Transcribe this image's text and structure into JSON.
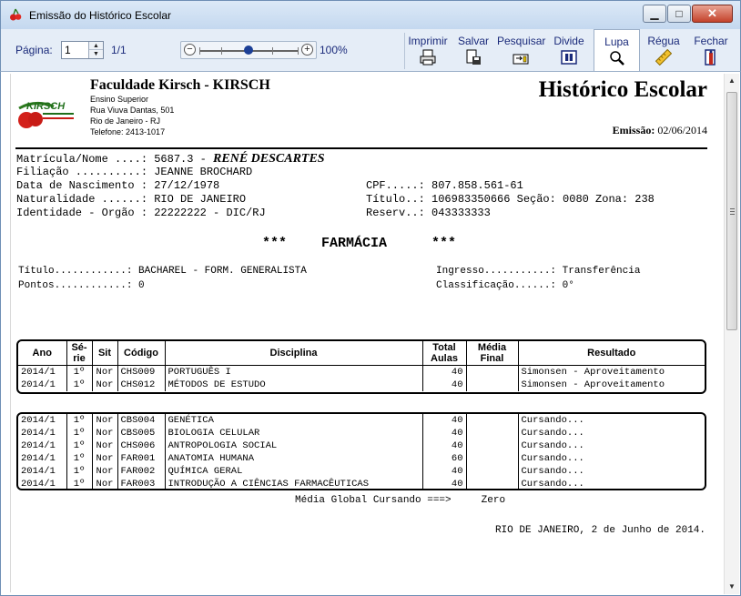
{
  "window": {
    "title": "Emissão do Histórico Escolar",
    "min_glyph": "▁",
    "max_glyph": "□",
    "close_glyph": "✕"
  },
  "toolbar": {
    "page_label": "Página:",
    "page_value": "1",
    "page_total": "1/1",
    "zoom_value": "100%",
    "buttons": {
      "imprimir": "Imprimir",
      "salvar": "Salvar",
      "pesquisar": "Pesquisar",
      "divide": "Divide",
      "lupa": "Lupa",
      "regua": "Régua",
      "fechar": "Fechar"
    }
  },
  "document": {
    "institution": {
      "name": "Faculdade Kirsch - KIRSCH",
      "lines": [
        "Ensino Superior",
        "Rua Viuva Dantas, 501",
        "Rio de Janeiro - RJ",
        "Telefone: 2413-1017"
      ],
      "logo_text": "KIRSCH"
    },
    "title": "Histórico Escolar",
    "emissao_label": "Emissão:",
    "emissao_date": "02/06/2014",
    "student": {
      "matricula_label": "Matrícula/Nome ....:",
      "matricula_value": "5687.3 -",
      "name": "RENÉ DESCARTES",
      "filiacao_label": "Filiação ..........:",
      "filiacao_value": "JEANNE BROCHARD",
      "nascimento_label": "Data de Nascimento :",
      "nascimento_value": "27/12/1978",
      "naturalidade_label": "Naturalidade ......:",
      "naturalidade_value": "RIO DE JANEIRO",
      "identidade_label": "Identidade - Orgão :",
      "identidade_value": "22222222 - DIC/RJ",
      "cpf_label": "CPF.....:",
      "cpf_value": "807.858.561-61",
      "titulo_label": "Título..:",
      "titulo_value": "106983350666 Seção: 0080 Zona: 238",
      "reserv_label": "Reserv..:",
      "reserv_value": "043333333"
    },
    "course": {
      "stars_left": "***",
      "name": "FARMÁCIA",
      "stars_right": "***"
    },
    "academic": {
      "titulo_label": "Título............:",
      "titulo_value": "BACHAREL - FORM. GENERALISTA",
      "pontos_label": "Pontos............:",
      "pontos_value": "0",
      "ingresso_label": "Ingresso...........:",
      "ingresso_value": "Transferência",
      "classificacao_label": "Classificação......:",
      "classificacao_value": "0°"
    },
    "table": {
      "headers": {
        "ano": "Ano",
        "serie": "Sé-\nrie",
        "sit": "Sit",
        "codigo": "Código",
        "disciplina": "Disciplina",
        "total_aulas": "Total\nAulas",
        "media_final": "Média\nFinal",
        "resultado": "Resultado"
      },
      "completed": [
        {
          "ano": "2014/1",
          "serie": "1º",
          "sit": "Nor",
          "codigo": "CHS009",
          "disciplina": "PORTUGUÊS I",
          "aulas": "40",
          "media": "",
          "resultado": "Simonsen - Aproveitamento"
        },
        {
          "ano": "2014/1",
          "serie": "1º",
          "sit": "Nor",
          "codigo": "CHS012",
          "disciplina": "MÉTODOS DE ESTUDO",
          "aulas": "40",
          "media": "",
          "resultado": "Simonsen - Aproveitamento"
        }
      ],
      "current": [
        {
          "ano": "2014/1",
          "serie": "1º",
          "sit": "Nor",
          "codigo": "CBS004",
          "disciplina": "GENÉTICA",
          "aulas": "40",
          "media": "",
          "resultado": "Cursando..."
        },
        {
          "ano": "2014/1",
          "serie": "1º",
          "sit": "Nor",
          "codigo": "CBS005",
          "disciplina": "BIOLOGIA CELULAR",
          "aulas": "40",
          "media": "",
          "resultado": "Cursando..."
        },
        {
          "ano": "2014/1",
          "serie": "1º",
          "sit": "Nor",
          "codigo": "CHS006",
          "disciplina": "ANTROPOLOGIA SOCIAL",
          "aulas": "40",
          "media": "",
          "resultado": "Cursando..."
        },
        {
          "ano": "2014/1",
          "serie": "1º",
          "sit": "Nor",
          "codigo": "FAR001",
          "disciplina": "ANATOMIA HUMANA",
          "aulas": "60",
          "media": "",
          "resultado": "Cursando..."
        },
        {
          "ano": "2014/1",
          "serie": "1º",
          "sit": "Nor",
          "codigo": "FAR002",
          "disciplina": "QUÍMICA GERAL",
          "aulas": "40",
          "media": "",
          "resultado": "Cursando..."
        },
        {
          "ano": "2014/1",
          "serie": "1º",
          "sit": "Nor",
          "codigo": "FAR003",
          "disciplina": "INTRODUÇÃO A CIÊNCIAS FARMACÊUTICAS",
          "aulas": "40",
          "media": "",
          "resultado": "Cursando..."
        }
      ]
    },
    "media_global_label": "Média Global Cursando ===>",
    "media_global_value": "Zero",
    "place_date": "RIO DE JANEIRO, 2 de Junho de 2014."
  }
}
